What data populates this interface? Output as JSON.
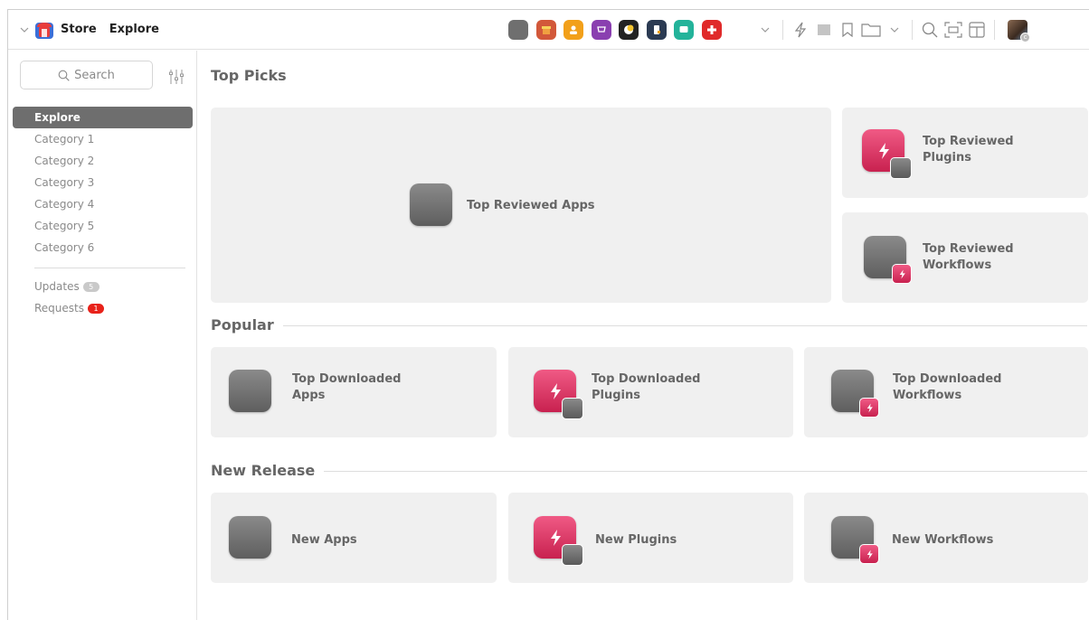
{
  "toolbar": {
    "breadcrumb": {
      "app": "Store",
      "page": "Explore"
    },
    "app_icons": [
      {
        "name": "gray-app-icon",
        "color": "#6f6f6f"
      },
      {
        "name": "archive-app-icon",
        "color": "#d2583a"
      },
      {
        "name": "contact-app-icon",
        "color": "#f2a01a"
      },
      {
        "name": "cart-app-icon",
        "color": "#8a3fb0"
      },
      {
        "name": "moon-app-icon",
        "color": "#222222"
      },
      {
        "name": "phone-app-icon",
        "color": "#2b3a52"
      },
      {
        "name": "chat-app-icon",
        "color": "#23b39a"
      },
      {
        "name": "cross-app-icon",
        "color": "#e02a2a"
      }
    ]
  },
  "sidebar": {
    "search_placeholder": "Search",
    "nav": [
      {
        "label": "Explore",
        "active": true
      },
      {
        "label": "Category 1"
      },
      {
        "label": "Category 2"
      },
      {
        "label": "Category 3"
      },
      {
        "label": "Category 4"
      },
      {
        "label": "Category 5"
      },
      {
        "label": "Category 6"
      }
    ],
    "updates": {
      "label": "Updates",
      "count": "5"
    },
    "requests": {
      "label": "Requests",
      "count": "1"
    }
  },
  "main": {
    "top_picks": {
      "title": "Top Picks",
      "apps": "Top Reviewed Apps",
      "plugins": "Top Reviewed Plugins",
      "workflows": "Top Reviewed Workflows"
    },
    "popular": {
      "title": "Popular",
      "apps": "Top Downloaded Apps",
      "plugins": "Top Downloaded Plugins",
      "workflows": "Top Downloaded Workflows"
    },
    "new_release": {
      "title": "New Release",
      "apps": "New Apps",
      "plugins": "New Plugins",
      "workflows": "New Workflows"
    }
  },
  "colors": {
    "accent_plugin": "#e03466",
    "badge_red": "#e8221a",
    "active_nav": "#6e6e6e"
  }
}
